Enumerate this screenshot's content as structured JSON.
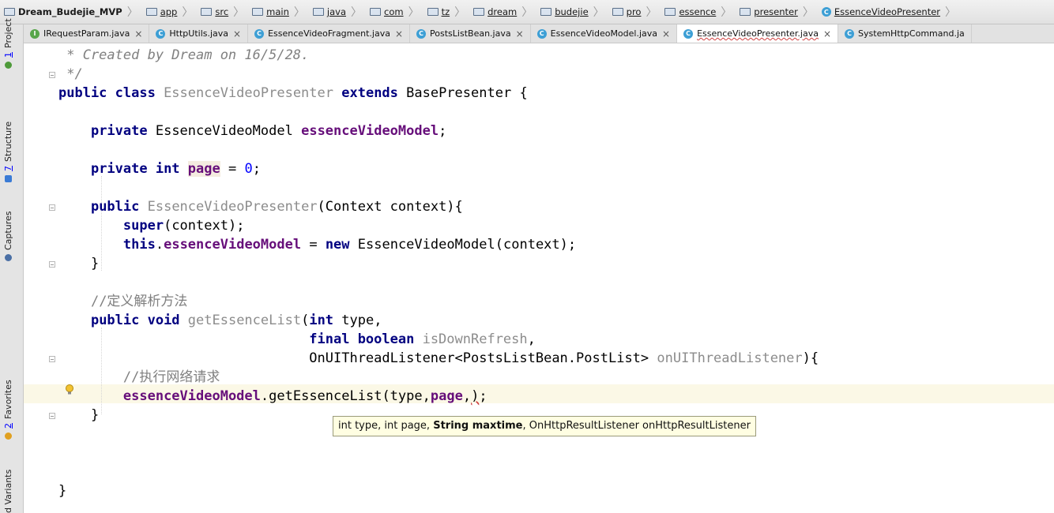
{
  "navbar": {
    "crumbs": [
      {
        "label": "Dream_Budejie_MVP",
        "icon": "folder-icon"
      },
      {
        "label": "app",
        "icon": "folder-icon"
      },
      {
        "label": "src",
        "icon": "folder-icon"
      },
      {
        "label": "main",
        "icon": "folder-icon"
      },
      {
        "label": "java",
        "icon": "folder-icon"
      },
      {
        "label": "com",
        "icon": "package-icon"
      },
      {
        "label": "tz",
        "icon": "package-icon"
      },
      {
        "label": "dream",
        "icon": "package-icon"
      },
      {
        "label": "budejie",
        "icon": "package-icon"
      },
      {
        "label": "pro",
        "icon": "package-icon"
      },
      {
        "label": "essence",
        "icon": "package-icon"
      },
      {
        "label": "presenter",
        "icon": "package-icon"
      },
      {
        "label": "EssenceVideoPresenter",
        "icon": "class-icon"
      }
    ]
  },
  "tabs": [
    {
      "label": "IRequestParam.java",
      "kind": "I",
      "active": false
    },
    {
      "label": "HttpUtils.java",
      "kind": "C",
      "active": false
    },
    {
      "label": "EssenceVideoFragment.java",
      "kind": "C",
      "active": false
    },
    {
      "label": "PostsListBean.java",
      "kind": "C",
      "active": false
    },
    {
      "label": "EssenceVideoModel.java",
      "kind": "C",
      "active": false
    },
    {
      "label": "EssenceVideoPresenter.java",
      "kind": "C",
      "active": true
    },
    {
      "label": "SystemHttpCommand.ja",
      "kind": "C",
      "active": false
    }
  ],
  "sidebar": {
    "items": [
      {
        "num": "1",
        "label": "Project"
      },
      {
        "num": "7",
        "label": "Structure"
      },
      {
        "num": "",
        "label": "Captures"
      },
      {
        "num": "2",
        "label": "Favorites"
      },
      {
        "num": "",
        "label": "d Variants"
      }
    ]
  },
  "code": {
    "line_created": " * Created by Dream on 16/5/28.",
    "line_close_comment": " */",
    "comment_parse": "//定义解析方法",
    "comment_request": "//执行网络请求",
    "class_name": "EssenceVideoPresenter",
    "base_class": "BasePresenter",
    "model_type": "EssenceVideoModel",
    "model_field": "essenceVideoModel",
    "page_field": "page",
    "page_init": "0",
    "method_name": "getEssenceList",
    "listener_type": "OnUIThreadListener<PostsListBean.PostList>",
    "listener_param": "onUIThreadListener"
  },
  "tooltip": {
    "before": "int type, int page, ",
    "highlight": "String maxtime",
    "after": ", OnHttpResultListener onHttpResultListener"
  }
}
